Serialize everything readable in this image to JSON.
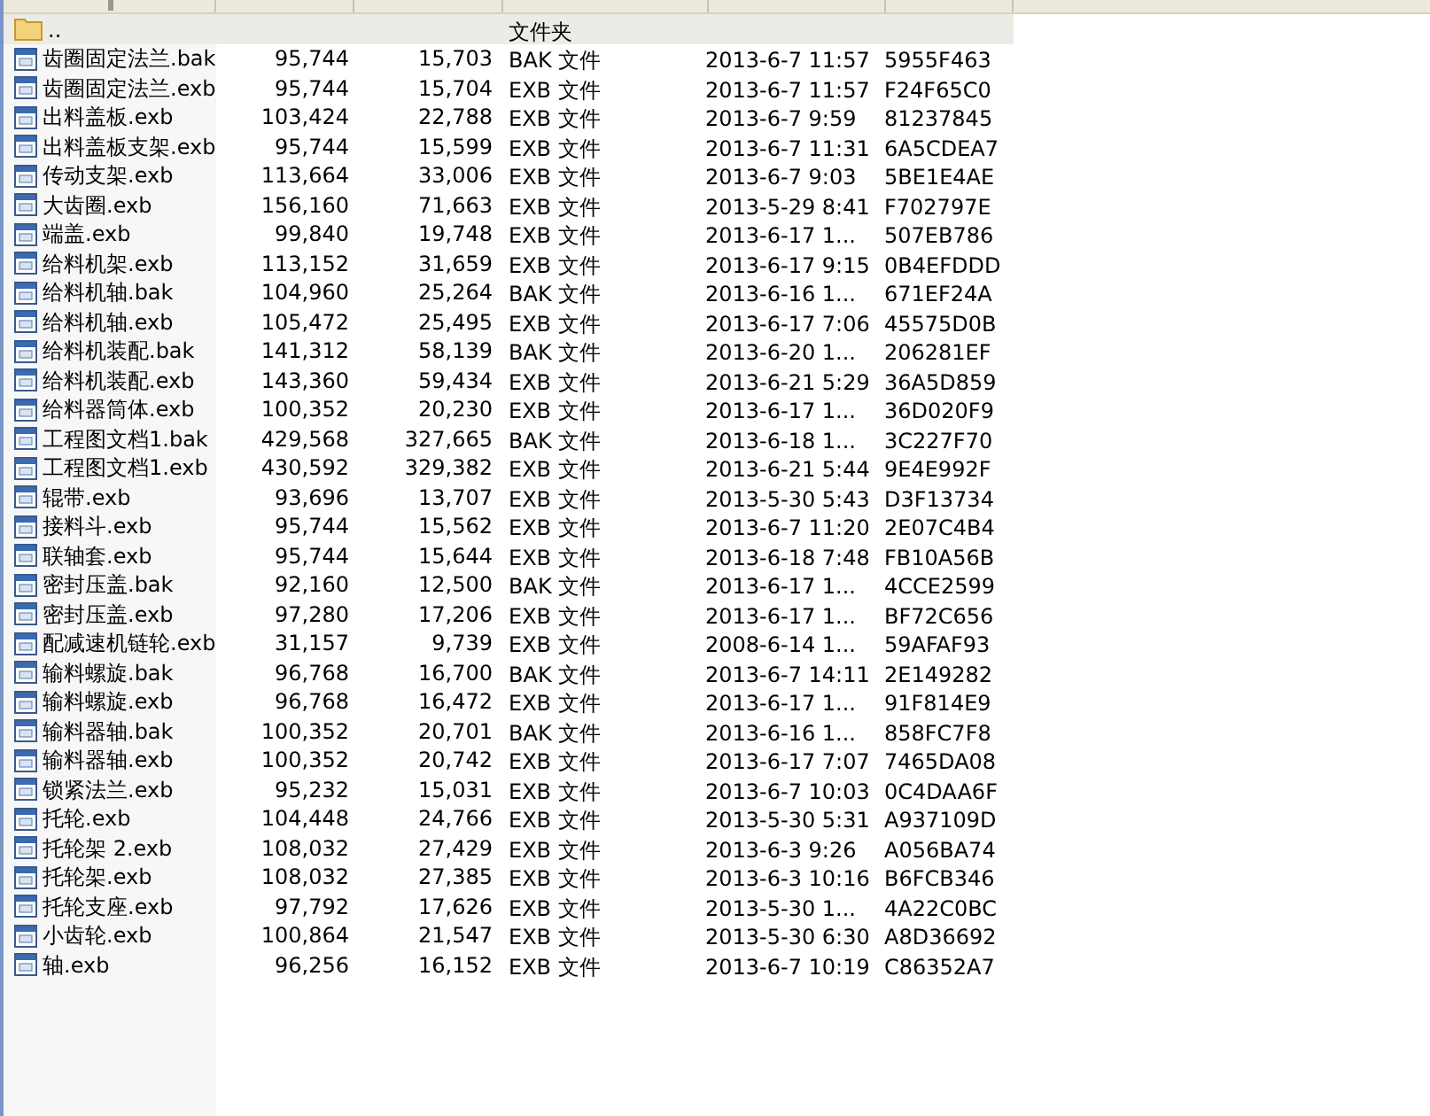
{
  "rows": [
    {
      "kind": "folder",
      "name": "..",
      "size": "",
      "packed": "",
      "type": "文件夹",
      "modified": "",
      "crc": "",
      "selected": true
    },
    {
      "kind": "file",
      "name": "齿圈固定法兰.bak",
      "size": "95,744",
      "packed": "15,703",
      "type": "BAK 文件",
      "modified": "2013-6-7 11:57",
      "crc": "5955F463",
      "selected": false
    },
    {
      "kind": "file",
      "name": "齿圈固定法兰.exb",
      "size": "95,744",
      "packed": "15,704",
      "type": "EXB 文件",
      "modified": "2013-6-7 11:57",
      "crc": "F24F65C0",
      "selected": false
    },
    {
      "kind": "file",
      "name": "出料盖板.exb",
      "size": "103,424",
      "packed": "22,788",
      "type": "EXB 文件",
      "modified": "2013-6-7 9:59",
      "crc": "81237845",
      "selected": false
    },
    {
      "kind": "file",
      "name": "出料盖板支架.exb",
      "size": "95,744",
      "packed": "15,599",
      "type": "EXB 文件",
      "modified": "2013-6-7 11:31",
      "crc": "6A5CDEA7",
      "selected": false
    },
    {
      "kind": "file",
      "name": "传动支架.exb",
      "size": "113,664",
      "packed": "33,006",
      "type": "EXB 文件",
      "modified": "2013-6-7 9:03",
      "crc": "5BE1E4AE",
      "selected": false
    },
    {
      "kind": "file",
      "name": "大齿圈.exb",
      "size": "156,160",
      "packed": "71,663",
      "type": "EXB 文件",
      "modified": "2013-5-29 8:41",
      "crc": "F702797E",
      "selected": false
    },
    {
      "kind": "file",
      "name": "端盖.exb",
      "size": "99,840",
      "packed": "19,748",
      "type": "EXB 文件",
      "modified": "2013-6-17 1...",
      "crc": "507EB786",
      "selected": false
    },
    {
      "kind": "file",
      "name": "给料机架.exb",
      "size": "113,152",
      "packed": "31,659",
      "type": "EXB 文件",
      "modified": "2013-6-17 9:15",
      "crc": "0B4EFDDD",
      "selected": false
    },
    {
      "kind": "file",
      "name": "给料机轴.bak",
      "size": "104,960",
      "packed": "25,264",
      "type": "BAK 文件",
      "modified": "2013-6-16 1...",
      "crc": "671EF24A",
      "selected": false
    },
    {
      "kind": "file",
      "name": "给料机轴.exb",
      "size": "105,472",
      "packed": "25,495",
      "type": "EXB 文件",
      "modified": "2013-6-17 7:06",
      "crc": "45575D0B",
      "selected": false
    },
    {
      "kind": "file",
      "name": "给料机装配.bak",
      "size": "141,312",
      "packed": "58,139",
      "type": "BAK 文件",
      "modified": "2013-6-20 1...",
      "crc": "206281EF",
      "selected": false
    },
    {
      "kind": "file",
      "name": "给料机装配.exb",
      "size": "143,360",
      "packed": "59,434",
      "type": "EXB 文件",
      "modified": "2013-6-21 5:29",
      "crc": "36A5D859",
      "selected": false
    },
    {
      "kind": "file",
      "name": "给料器筒体.exb",
      "size": "100,352",
      "packed": "20,230",
      "type": "EXB 文件",
      "modified": "2013-6-17 1...",
      "crc": "36D020F9",
      "selected": false
    },
    {
      "kind": "file",
      "name": "工程图文档1.bak",
      "size": "429,568",
      "packed": "327,665",
      "type": "BAK 文件",
      "modified": "2013-6-18 1...",
      "crc": "3C227F70",
      "selected": false
    },
    {
      "kind": "file",
      "name": "工程图文档1.exb",
      "size": "430,592",
      "packed": "329,382",
      "type": "EXB 文件",
      "modified": "2013-6-21 5:44",
      "crc": "9E4E992F",
      "selected": false
    },
    {
      "kind": "file",
      "name": "辊带.exb",
      "size": "93,696",
      "packed": "13,707",
      "type": "EXB 文件",
      "modified": "2013-5-30 5:43",
      "crc": "D3F13734",
      "selected": false
    },
    {
      "kind": "file",
      "name": "接料斗.exb",
      "size": "95,744",
      "packed": "15,562",
      "type": "EXB 文件",
      "modified": "2013-6-7 11:20",
      "crc": "2E07C4B4",
      "selected": false
    },
    {
      "kind": "file",
      "name": "联轴套.exb",
      "size": "95,744",
      "packed": "15,644",
      "type": "EXB 文件",
      "modified": "2013-6-18 7:48",
      "crc": "FB10A56B",
      "selected": false
    },
    {
      "kind": "file",
      "name": "密封压盖.bak",
      "size": "92,160",
      "packed": "12,500",
      "type": "BAK 文件",
      "modified": "2013-6-17 1...",
      "crc": "4CCE2599",
      "selected": false
    },
    {
      "kind": "file",
      "name": "密封压盖.exb",
      "size": "97,280",
      "packed": "17,206",
      "type": "EXB 文件",
      "modified": "2013-6-17 1...",
      "crc": "BF72C656",
      "selected": false
    },
    {
      "kind": "file",
      "name": "配减速机链轮.exb",
      "size": "31,157",
      "packed": "9,739",
      "type": "EXB 文件",
      "modified": "2008-6-14 1...",
      "crc": "59AFAF93",
      "selected": false
    },
    {
      "kind": "file",
      "name": "输料螺旋.bak",
      "size": "96,768",
      "packed": "16,700",
      "type": "BAK 文件",
      "modified": "2013-6-7 14:11",
      "crc": "2E149282",
      "selected": false
    },
    {
      "kind": "file",
      "name": "输料螺旋.exb",
      "size": "96,768",
      "packed": "16,472",
      "type": "EXB 文件",
      "modified": "2013-6-17 1...",
      "crc": "91F814E9",
      "selected": false
    },
    {
      "kind": "file",
      "name": "输料器轴.bak",
      "size": "100,352",
      "packed": "20,701",
      "type": "BAK 文件",
      "modified": "2013-6-16 1...",
      "crc": "858FC7F8",
      "selected": false
    },
    {
      "kind": "file",
      "name": "输料器轴.exb",
      "size": "100,352",
      "packed": "20,742",
      "type": "EXB 文件",
      "modified": "2013-6-17 7:07",
      "crc": "7465DA08",
      "selected": false
    },
    {
      "kind": "file",
      "name": "锁紧法兰.exb",
      "size": "95,232",
      "packed": "15,031",
      "type": "EXB 文件",
      "modified": "2013-6-7 10:03",
      "crc": "0C4DAA6F",
      "selected": false
    },
    {
      "kind": "file",
      "name": "托轮.exb",
      "size": "104,448",
      "packed": "24,766",
      "type": "EXB 文件",
      "modified": "2013-5-30 5:31",
      "crc": "A937109D",
      "selected": false
    },
    {
      "kind": "file",
      "name": "托轮架 2.exb",
      "size": "108,032",
      "packed": "27,429",
      "type": "EXB 文件",
      "modified": "2013-6-3 9:26",
      "crc": "A056BA74",
      "selected": false
    },
    {
      "kind": "file",
      "name": "托轮架.exb",
      "size": "108,032",
      "packed": "27,385",
      "type": "EXB 文件",
      "modified": "2013-6-3 10:16",
      "crc": "B6FCB346",
      "selected": false
    },
    {
      "kind": "file",
      "name": "托轮支座.exb",
      "size": "97,792",
      "packed": "17,626",
      "type": "EXB 文件",
      "modified": "2013-5-30 1...",
      "crc": "4A22C0BC",
      "selected": false
    },
    {
      "kind": "file",
      "name": "小齿轮.exb",
      "size": "100,864",
      "packed": "21,547",
      "type": "EXB 文件",
      "modified": "2013-5-30 6:30",
      "crc": "A8D36692",
      "selected": false
    },
    {
      "kind": "file",
      "name": "轴.exb",
      "size": "96,256",
      "packed": "16,152",
      "type": "EXB 文件",
      "modified": "2013-6-7 10:19",
      "crc": "C86352A7",
      "selected": false
    }
  ]
}
